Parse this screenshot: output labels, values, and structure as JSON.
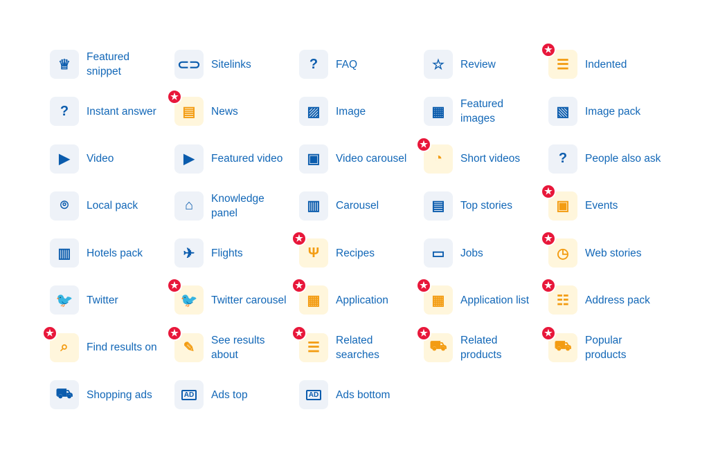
{
  "colors": {
    "text": "#1267b7",
    "icon": "#0b5cad",
    "box": "#eef2f8",
    "new_box": "#fff6dc",
    "new_icon": "#f39c12",
    "badge": "#e8173a"
  },
  "badge_icon": "star-icon",
  "items": [
    {
      "label": "Featured snippet",
      "icon": "crown-icon",
      "glyph": "♕",
      "new": false
    },
    {
      "label": "Sitelinks",
      "icon": "link-icon",
      "glyph": "⊂⊃",
      "new": false
    },
    {
      "label": "FAQ",
      "icon": "question-circle-icon",
      "glyph": "?",
      "new": false
    },
    {
      "label": "Review",
      "icon": "star-outline-icon",
      "glyph": "☆",
      "new": false
    },
    {
      "label": "Indented",
      "icon": "indented-icon",
      "glyph": "☰",
      "new": true
    },
    {
      "label": "Instant answer",
      "icon": "question-circle-icon",
      "glyph": "?",
      "new": false
    },
    {
      "label": "News",
      "icon": "newspaper-icon",
      "glyph": "▤",
      "new": true
    },
    {
      "label": "Image",
      "icon": "image-icon",
      "glyph": "▨",
      "new": false
    },
    {
      "label": "Featured images",
      "icon": "presentation-icon",
      "glyph": "▦",
      "new": false
    },
    {
      "label": "Image pack",
      "icon": "image-pack-icon",
      "glyph": "▧",
      "new": false
    },
    {
      "label": "Video",
      "icon": "play-circle-icon",
      "glyph": "▶",
      "new": false
    },
    {
      "label": "Featured video",
      "icon": "video-icon",
      "glyph": "▶",
      "new": false
    },
    {
      "label": "Video carousel",
      "icon": "video-carousel-icon",
      "glyph": "▣",
      "new": false
    },
    {
      "label": "Short videos",
      "icon": "short-video-icon",
      "glyph": "◔",
      "new": true
    },
    {
      "label": "People also ask",
      "icon": "chat-question-icon",
      "glyph": "?",
      "new": false
    },
    {
      "label": "Local pack",
      "icon": "map-pin-icon",
      "glyph": "⌾",
      "new": false
    },
    {
      "label": "Knowledge panel",
      "icon": "graduation-cap-icon",
      "glyph": "⌂",
      "new": false
    },
    {
      "label": "Carousel",
      "icon": "carousel-icon",
      "glyph": "▥",
      "new": false
    },
    {
      "label": "Top stories",
      "icon": "document-icon",
      "glyph": "▤",
      "new": false
    },
    {
      "label": "Events",
      "icon": "calendar-star-icon",
      "glyph": "▣",
      "new": true
    },
    {
      "label": "Hotels pack",
      "icon": "hotel-icon",
      "glyph": "▥",
      "new": false
    },
    {
      "label": "Flights",
      "icon": "plane-icon",
      "glyph": "✈",
      "new": false
    },
    {
      "label": "Recipes",
      "icon": "cutlery-icon",
      "glyph": "Ψ",
      "new": true
    },
    {
      "label": "Jobs",
      "icon": "briefcase-icon",
      "glyph": "▭",
      "new": false
    },
    {
      "label": "Web stories",
      "icon": "clock-icon",
      "glyph": "◷",
      "new": true
    },
    {
      "label": "Twitter",
      "icon": "twitter-icon",
      "glyph": "🐦",
      "new": false
    },
    {
      "label": "Twitter carousel",
      "icon": "twitter-carousel-icon",
      "glyph": "🐦",
      "new": true
    },
    {
      "label": "Application",
      "icon": "apps-grid-icon",
      "glyph": "▦",
      "new": true
    },
    {
      "label": "Application list",
      "icon": "apps-add-icon",
      "glyph": "▦",
      "new": true
    },
    {
      "label": "Address pack",
      "icon": "address-list-icon",
      "glyph": "☷",
      "new": true
    },
    {
      "label": "Find results on",
      "icon": "search-check-icon",
      "glyph": "⌕",
      "new": true
    },
    {
      "label": "See results about",
      "icon": "checklist-icon",
      "glyph": "✎",
      "new": true
    },
    {
      "label": "Related searches",
      "icon": "list-icon",
      "glyph": "☰",
      "new": true
    },
    {
      "label": "Related products",
      "icon": "cart-list-icon",
      "glyph": "⛟",
      "new": true
    },
    {
      "label": "Popular products",
      "icon": "cart-icon",
      "glyph": "⛟",
      "new": true
    },
    {
      "label": "Shopping ads",
      "icon": "shopping-cart-icon",
      "glyph": "⛟",
      "new": false
    },
    {
      "label": "Ads top",
      "icon": "ad-top-icon",
      "glyph": "AD",
      "new": false
    },
    {
      "label": "Ads bottom",
      "icon": "ad-bottom-icon",
      "glyph": "AD",
      "new": false
    }
  ]
}
